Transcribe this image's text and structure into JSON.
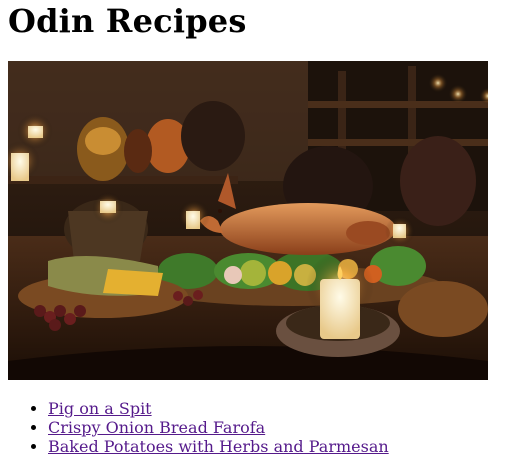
{
  "page": {
    "title": "Odin Recipes"
  },
  "recipes": [
    {
      "label": "Pig on a Spit"
    },
    {
      "label": "Crispy Onion Bread Farofa"
    },
    {
      "label": "Baked Potatoes with Herbs and Parmesan"
    }
  ],
  "colors": {
    "link_visited": "#551a8b",
    "text": "#000000",
    "background": "#ffffff"
  }
}
